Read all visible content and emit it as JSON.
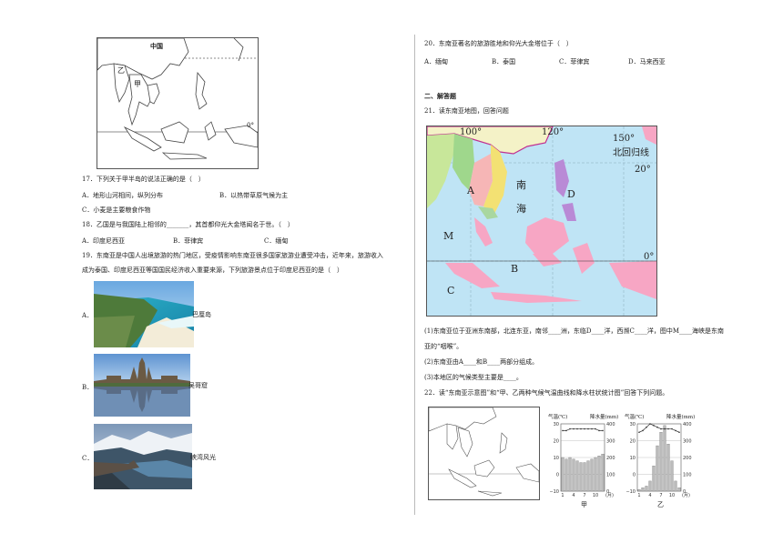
{
  "left": {
    "map1": {
      "label_china": "中国",
      "label_yi": "乙",
      "label_jia": "甲",
      "label_zero": "0°"
    },
    "q17": {
      "stem": "17．下列关于甲半岛的说法正确的是（　）",
      "opts": [
        "A．地形山河相间，纵列分布",
        "B．以热带草原气候为主",
        "C．小麦是主要粮食作物"
      ]
    },
    "q18": {
      "stem": "18．乙国是与我国陆上相邻的_______，其首都仰光大金塔闻名于世。（　）",
      "opts": [
        "A．印度尼西亚",
        "B．菲律宾",
        "C．缅甸"
      ]
    },
    "q19": {
      "stem1": "19．东南亚是中国人出境旅游的热门地区，受疫情影响东南亚很多国家旅游业遭受冲击，近年来，旅游收入",
      "stem2": "成为泰国、印度尼西亚等国国民经济收入重要来源，下列旅游景点位于印度尼西亚的是（　）",
      "opts": [
        {
          "letter": "A．",
          "caption": "巴厘岛"
        },
        {
          "letter": "B．",
          "caption": "吴哥窟"
        },
        {
          "letter": "C．",
          "caption": "峡湾风光"
        }
      ]
    }
  },
  "right": {
    "q20": {
      "stem": "20．东南亚著名的旅游胜地和仰光大金塔位于（　）",
      "opts": [
        "A．缅甸",
        "B．泰国",
        "C．菲律宾",
        "D．马来西亚"
      ]
    },
    "section": "二、解答题",
    "q21": {
      "stem": "21．读东南亚地图，回答问题",
      "map": {
        "lon100": "100°",
        "lon120": "120°",
        "lon150": "150°",
        "tropic": "北回归线",
        "lat20": "20°",
        "lat0": "0°",
        "sea1": "南",
        "sea2": "海",
        "A": "A",
        "B": "B",
        "C": "C",
        "D": "D",
        "M": "M"
      },
      "lines": [
        "(1)东南亚位于亚洲东南部，北连东亚，南邻____洲，东临D____洋，西濒C____洋，图中M____海峡是东南",
        "亚的“咽喉”。",
        "(2)东南亚由A____和B____两部分组成。",
        "(3)本地区的气候类型主要是____。"
      ]
    },
    "q22": {
      "stem": "22．读“东南亚示意图”和“甲、乙两种气候气温曲线和降水柱状统计图”回答下列问题。",
      "charts": [
        {
          "name": "甲",
          "ylabel_left": "气温(℃)",
          "ylabel_right": "降水量(mm)",
          "left_ticks": [
            "30",
            "20",
            "10",
            "0",
            "−10"
          ],
          "right_ticks": [
            "400",
            "300",
            "200",
            "100",
            "0"
          ],
          "x_ticks": [
            "1",
            "4",
            "7",
            "10"
          ],
          "x_unit": "(月)"
        },
        {
          "name": "乙",
          "ylabel_left": "气温(℃)",
          "ylabel_right": "降水量(mm)",
          "left_ticks": [
            "30",
            "20",
            "10",
            "0",
            "−10"
          ],
          "right_ticks": [
            "400",
            "300",
            "200",
            "100",
            "0"
          ],
          "x_ticks": [
            "1",
            "4",
            "7",
            "10"
          ],
          "x_unit": "(月)"
        }
      ]
    }
  },
  "chart_data": [
    {
      "type": "bar",
      "name": "甲",
      "x": [
        1,
        2,
        3,
        4,
        5,
        6,
        7,
        8,
        9,
        10,
        11,
        12
      ],
      "temperature": [
        26,
        26,
        27,
        27,
        27,
        27,
        27,
        27,
        27,
        27,
        26,
        26
      ],
      "precipitation": [
        200,
        190,
        200,
        190,
        180,
        170,
        170,
        180,
        190,
        200,
        210,
        220
      ],
      "ylim_temp": [
        -10,
        30
      ],
      "ylim_precip": [
        0,
        400
      ]
    },
    {
      "type": "bar",
      "name": "乙",
      "x": [
        1,
        2,
        3,
        4,
        5,
        6,
        7,
        8,
        9,
        10,
        11,
        12
      ],
      "temperature": [
        25,
        26,
        28,
        30,
        29,
        28,
        27,
        27,
        27,
        27,
        26,
        25
      ],
      "precipitation": [
        10,
        20,
        30,
        60,
        150,
        270,
        350,
        390,
        280,
        180,
        60,
        20
      ],
      "ylim_temp": [
        -10,
        30
      ],
      "ylim_precip": [
        0,
        400
      ]
    }
  ]
}
